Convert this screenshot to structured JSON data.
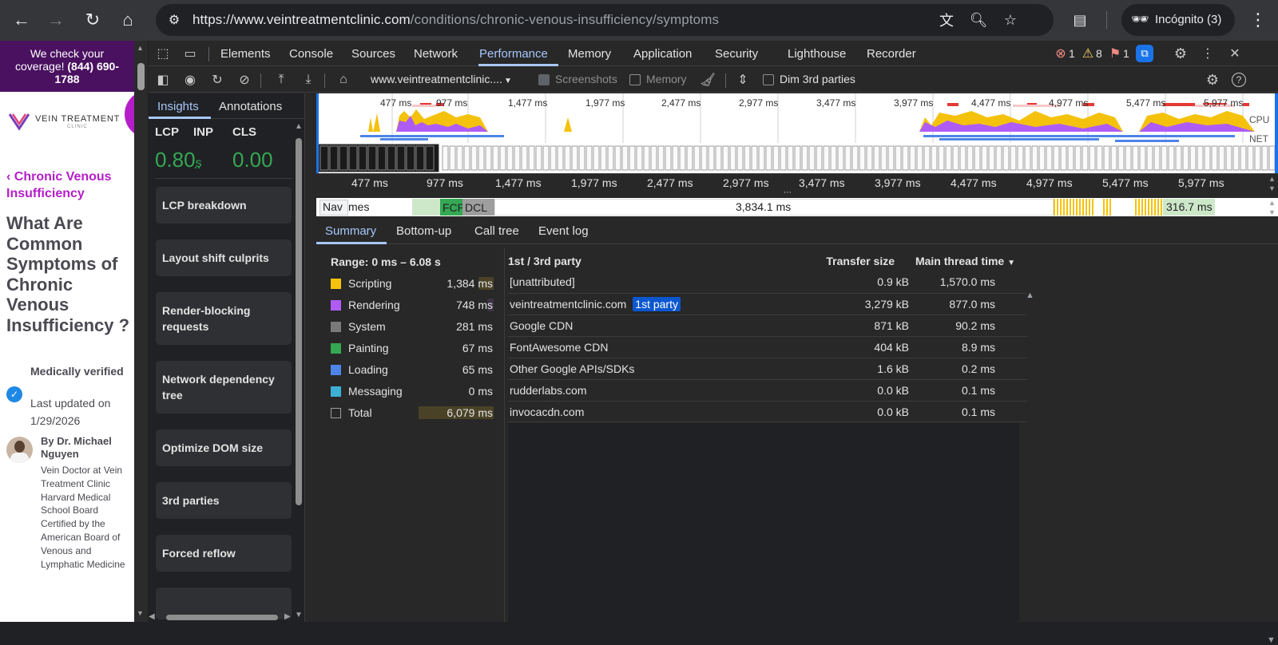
{
  "browser": {
    "url_host": "https://www.veintreatmentclinic.com",
    "url_path": "/conditions/chronic-venous-insufficiency/symptoms",
    "incognito_label": "Incógnito (3)"
  },
  "webpage": {
    "banner_line1": "We check your",
    "banner_line2": "coverage!",
    "banner_phone": "(844) 690-",
    "banner_phone2": "1788",
    "logo_text": "VEIN TREATMENT",
    "logo_sub": "CLINIC",
    "breadcrumb": "Chronic Venous Insufficiency",
    "headline": "What Are Common Symptoms of Chronic Venous Insufficiency ?",
    "verified": "Medically verified",
    "updated": "Last updated on 1/29/2026",
    "author": "By Dr. Michael Nguyen",
    "bio": "Vein Doctor at Vein Treatment Clinic Harvard Medical School Board Certified by the American Board of Venous and Lymphatic Medicine"
  },
  "devtools": {
    "tabs": [
      "Elements",
      "Console",
      "Sources",
      "Network",
      "Performance",
      "Memory",
      "Application",
      "Security",
      "Lighthouse",
      "Recorder"
    ],
    "active_tab": "Performance",
    "errors": "1",
    "warnings": "8",
    "issues": "1",
    "toolbar": {
      "target": "www.veintreatmentclinic....",
      "screenshots": "Screenshots",
      "memory": "Memory",
      "dim3p": "Dim 3rd parties"
    },
    "insights": {
      "tab1": "Insights",
      "tab2": "Annotations",
      "lcp_label": "LCP",
      "inp_label": "INP",
      "cls_label": "CLS",
      "lcp_value": "0.80",
      "lcp_unit": "s",
      "cls_value": "0.00",
      "cards": [
        "LCP breakdown",
        "Layout shift culprits",
        "Render-blocking requests",
        "Network dependency tree",
        "Optimize DOM size",
        "3rd parties",
        "Forced reflow"
      ]
    },
    "timeline": {
      "ticks": [
        "477 ms",
        "977 ms",
        "1,477 ms",
        "1,977 ms",
        "2,477 ms",
        "2,977 ms",
        "3,477 ms",
        "3,977 ms",
        "4,477 ms",
        "4,977 ms",
        "5,477 ms",
        "5,977 ms"
      ],
      "cpu_label": "CPU",
      "net_label": "NET",
      "nav_label": "Nav",
      "track_label": "mes",
      "fcp": "FCP",
      "dcl": "DCL",
      "long_frame": "3,834.1 ms",
      "short_frame": "316.7 ms"
    },
    "bottom_tabs": [
      "Summary",
      "Bottom-up",
      "Call tree",
      "Event log"
    ],
    "summary": {
      "range": "Range: 0 ms – 6.08 s",
      "rows": [
        {
          "name": "Scripting",
          "value": "1,384 ms",
          "color": "#f4c20d"
        },
        {
          "name": "Rendering",
          "value": "748 ms",
          "color": "#af5cf7"
        },
        {
          "name": "System",
          "value": "281 ms",
          "color": "#7a7a7a"
        },
        {
          "name": "Painting",
          "value": "67 ms",
          "color": "#34a853"
        },
        {
          "name": "Loading",
          "value": "65 ms",
          "color": "#4d84e8"
        },
        {
          "name": "Messaging",
          "value": "0 ms",
          "color": "#3db0d6"
        },
        {
          "name": "Total",
          "value": "6,079 ms",
          "color": ""
        }
      ]
    },
    "third_party": {
      "col1": "1st / 3rd party",
      "col2": "Transfer size",
      "col3": "Main thread time",
      "rows": [
        {
          "name": "[unattributed]",
          "size": "0.9 kB",
          "time": "1,570.0 ms",
          "tag": ""
        },
        {
          "name": "veintreatmentclinic.com",
          "size": "3,279 kB",
          "time": "877.0 ms",
          "tag": "1st party"
        },
        {
          "name": "Google CDN",
          "size": "871 kB",
          "time": "90.2 ms",
          "tag": ""
        },
        {
          "name": "FontAwesome CDN",
          "size": "404 kB",
          "time": "8.9 ms",
          "tag": ""
        },
        {
          "name": "Other Google APIs/SDKs",
          "size": "1.6 kB",
          "time": "0.2 ms",
          "tag": ""
        },
        {
          "name": "rudderlabs.com",
          "size": "0.0 kB",
          "time": "0.1 ms",
          "tag": ""
        },
        {
          "name": "invocacdn.com",
          "size": "0.0 kB",
          "time": "0.1 ms",
          "tag": ""
        }
      ]
    }
  }
}
